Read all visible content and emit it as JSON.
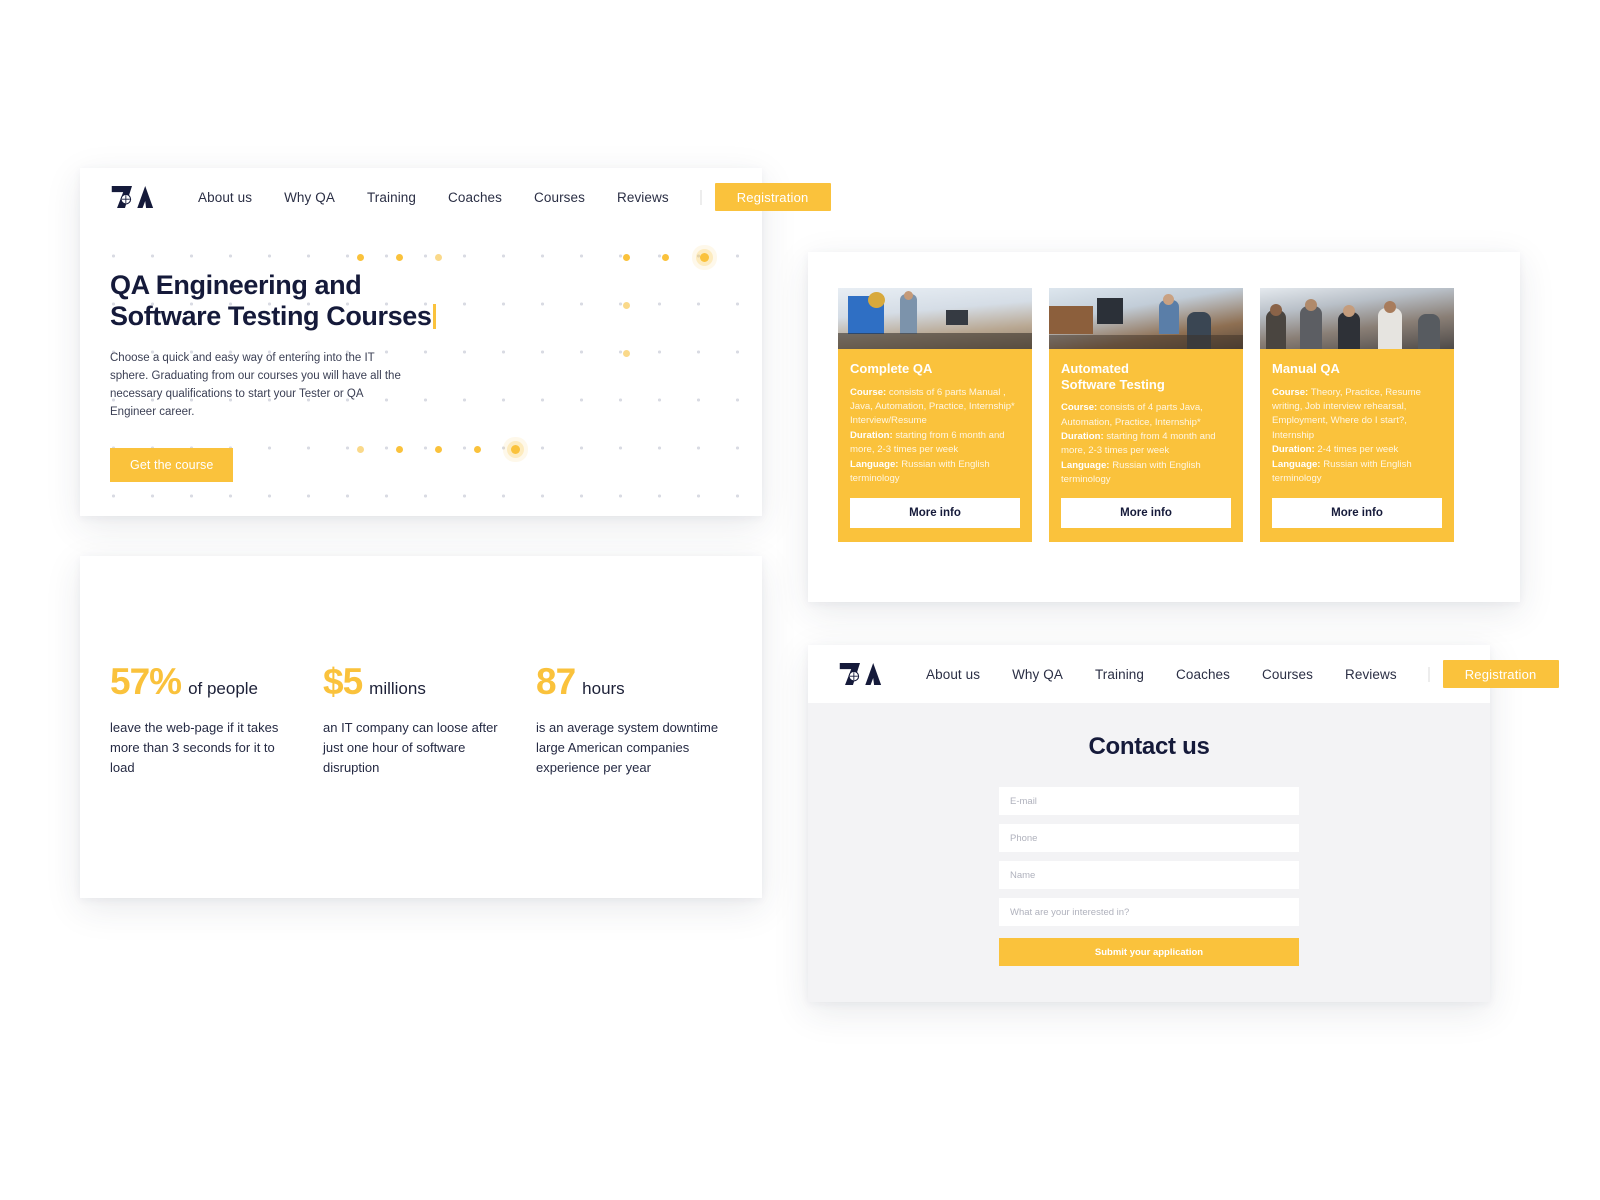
{
  "brand": {
    "logo_name": "7QA",
    "accent_color": "#FAC23C",
    "dark_color": "#151A3A"
  },
  "nav": {
    "links": [
      "About us",
      "Why QA",
      "Training",
      "Coaches",
      "Courses",
      "Reviews"
    ],
    "language_flag": "russia-flag-icon",
    "registration_label": "Registration"
  },
  "hero": {
    "title_line1": "QA Engineering and",
    "title_line2": "Software Testing Courses",
    "subtitle": "Choose a quick and easy way of entering into the IT sphere. Graduating from our courses you will have all the necessary qualifications to start your Tester or QA Engineer career.",
    "cta_label": "Get the course"
  },
  "stats": [
    {
      "number": "57%",
      "unit": "of people",
      "description": "leave the web-page if it takes more than 3 seconds for it to load"
    },
    {
      "number": "$5",
      "unit": "millions",
      "description": "an IT company can loose after just one hour of software disruption"
    },
    {
      "number": "87",
      "unit": "hours",
      "description": "is an average system downtime large American companies experience per year"
    }
  ],
  "courses": {
    "labels": {
      "course": "Course:",
      "duration": "Duration:",
      "language": "Language:"
    },
    "more_info_label": "More info",
    "cards": [
      {
        "title": "Complete QA",
        "image_name": "classroom-presentation-photo",
        "course": "consists of 6 parts Manual , Java, Automation, Practice, Internship* Interview/Resume",
        "duration": "starting from 6 month and more, 2-3 times per week",
        "language": "Russian with English terminology"
      },
      {
        "title": "Automated\nSoftware Testing",
        "image_name": "office-meeting-photo",
        "course": "consists of 4 parts Java, Automation, Practice, Internship*",
        "duration": "starting from 4 month and more, 2-3 times per week",
        "language": "Russian with English terminology"
      },
      {
        "title": "Manual QA",
        "image_name": "conference-audience-photo",
        "course": "Theory, Practice, Resume writing, Job interview rehearsal, Employment, Where do I start?, Internship",
        "duration": "2-4 times per week",
        "language": "Russian with English terminology"
      }
    ]
  },
  "contact": {
    "title": "Contact us",
    "fields": [
      {
        "name": "email",
        "placeholder": "E-mail",
        "value": ""
      },
      {
        "name": "phone",
        "placeholder": "Phone",
        "value": ""
      },
      {
        "name": "name",
        "placeholder": "Name",
        "value": ""
      },
      {
        "name": "interest",
        "placeholder": "What are your interested in?",
        "value": ""
      }
    ],
    "submit_label": "Submit your application"
  }
}
